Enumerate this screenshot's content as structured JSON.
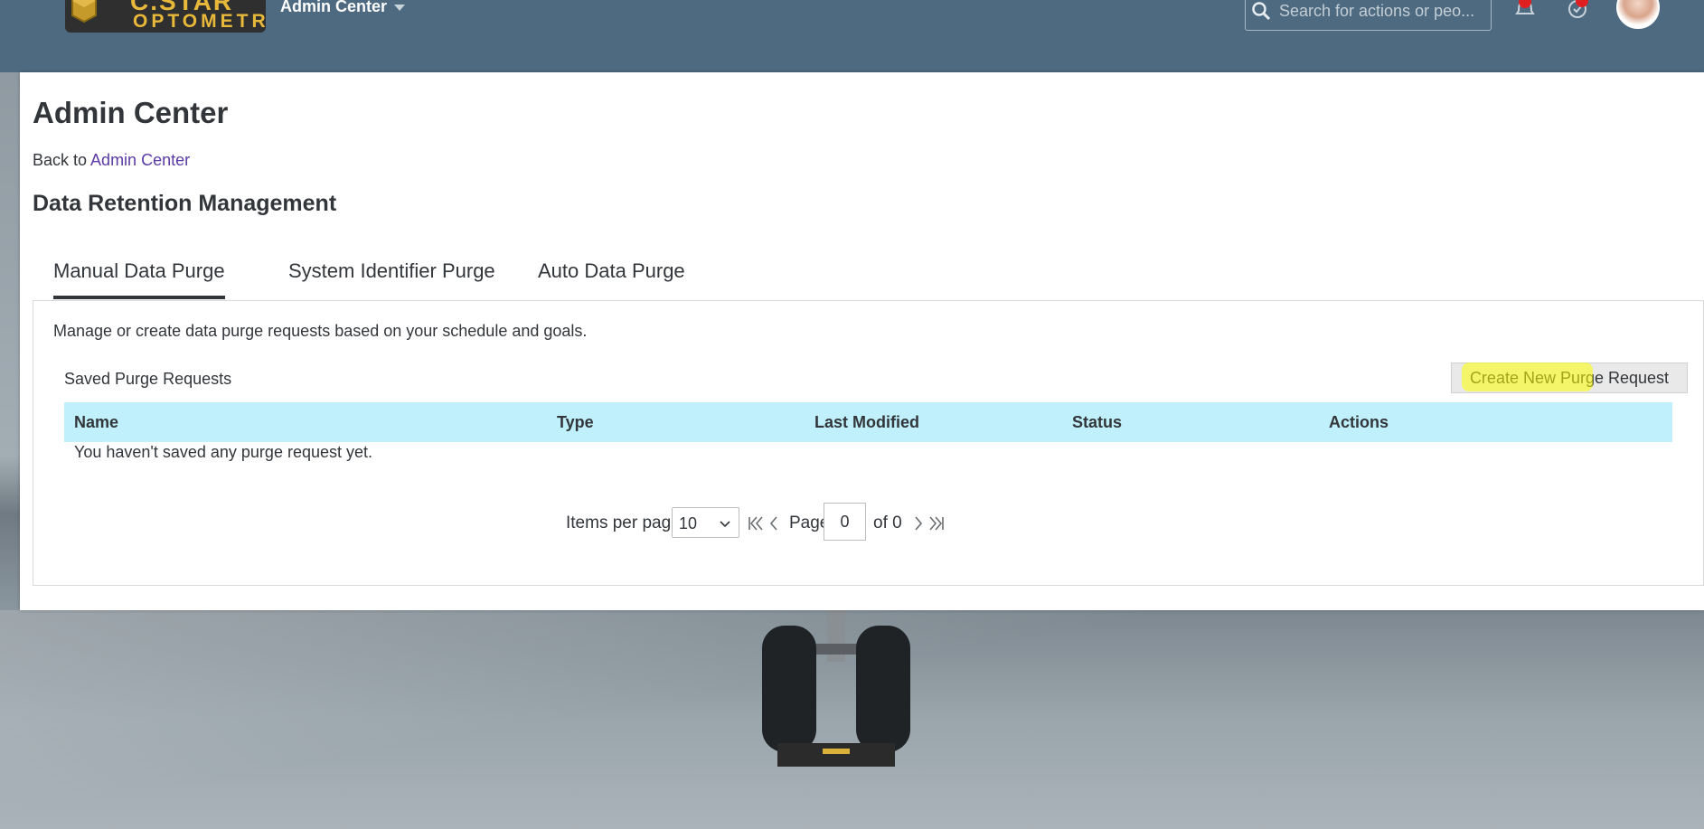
{
  "shell": {
    "logo_line1": "C.STAR",
    "logo_line2": "OPTOMETR",
    "title": "Admin Center",
    "search_placeholder": "Search for actions or peo...",
    "colors": {
      "bar": "#4e6a80",
      "logo_text": "#e8b83a",
      "notification_badge": "#e02020"
    },
    "icons": [
      "search-icon",
      "bell-icon",
      "approvals-icon",
      "avatar"
    ]
  },
  "page": {
    "title": "Admin Center",
    "back_prefix": "Back to",
    "back_link": "Admin Center",
    "section_title": "Data Retention Management"
  },
  "tabs": [
    {
      "label": "Manual Data Purge",
      "active": true
    },
    {
      "label": "System Identifier Purge",
      "active": false
    },
    {
      "label": "Auto Data Purge",
      "active": false
    }
  ],
  "manual": {
    "description": "Manage or create data purge requests based on your schedule and goals.",
    "saved_label": "Saved Purge Requests",
    "create_button": "Create New Purge Request",
    "columns": [
      "Name",
      "Type",
      "Last Modified",
      "Status",
      "Actions"
    ],
    "empty_message": "You haven't saved any purge request yet.",
    "header_color": "#bff0fb"
  },
  "pager": {
    "items_per_page_label": "Items per page",
    "items_per_page": "10",
    "page_label": "Page",
    "page_value": "0",
    "of_label": "of 0"
  }
}
